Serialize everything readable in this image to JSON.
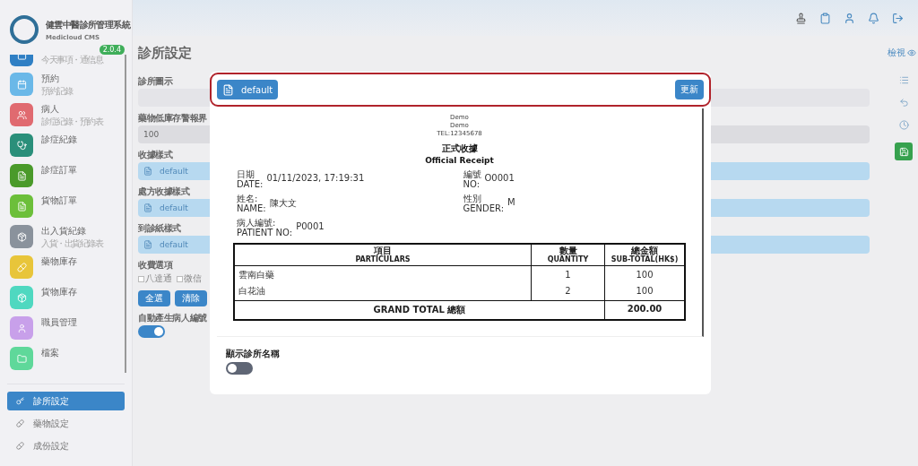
{
  "app": {
    "title": "健雲中醫診所管理系統",
    "subtitle": "Medicloud CMS",
    "version": "2.0.4"
  },
  "nav": [
    {
      "sub": "今天事項・通信息",
      "color": "#2f7fc4"
    },
    {
      "label": "預約",
      "sub": "預約記錄",
      "color": "#6ab8e8"
    },
    {
      "label": "病人",
      "sub": "診症紀錄・預約表",
      "color": "#e06a70"
    },
    {
      "label": "診症紀錄",
      "color": "#2a8f7a"
    },
    {
      "label": "診症訂單",
      "color": "#4a9a2a"
    },
    {
      "label": "貨物訂單",
      "color": "#6cbf3a"
    },
    {
      "label": "出入貨紀錄",
      "sub": "入貨・出貨紀錄表",
      "color": "#8a929c"
    },
    {
      "label": "藥物庫存",
      "color": "#e8c53a"
    },
    {
      "label": "貨物庫存",
      "color": "#4fd8c0"
    },
    {
      "label": "職員管理",
      "color": "#c8a0ea"
    },
    {
      "label": "檔案",
      "color": "#5fd89a"
    }
  ],
  "settings_nav": [
    {
      "label": "診所設定",
      "selected": true
    },
    {
      "label": "藥物設定",
      "selected": false
    },
    {
      "label": "成份設定",
      "selected": false
    }
  ],
  "page": {
    "title": "診所設定",
    "view_link": "檢視"
  },
  "fields": [
    {
      "kind": "empty",
      "label": "診所圖示"
    },
    {
      "kind": "number",
      "label": "藥物低庫存警報界",
      "value": "100"
    },
    {
      "kind": "template",
      "label": "收據樣式",
      "value": "default"
    },
    {
      "kind": "template",
      "label": "處方收據樣式",
      "value": "default"
    },
    {
      "kind": "template",
      "label": "到診紙樣式",
      "value": "default"
    },
    {
      "kind": "checks",
      "label": "收費選項",
      "options": [
        {
          "label": "八達通",
          "checked": false
        },
        {
          "label": "微信",
          "checked": false
        }
      ]
    },
    {
      "kind": "buttons",
      "buttons": [
        "全選",
        "清除"
      ]
    },
    {
      "kind": "toggle",
      "label": "自動產生病人編號",
      "on": true
    }
  ],
  "modal": {
    "template_button": "default",
    "update_button": "更新",
    "receipt": {
      "header": [
        "Demo",
        "Demo",
        "TEL:12345678"
      ],
      "title_zh": "正式收據",
      "title_en": "Official Receipt",
      "info": [
        [
          {
            "zh": "日期",
            "en": "DATE:",
            "value": "01/11/2023, 17:19:31"
          },
          {
            "zh": "編號",
            "en": "NO:",
            "value": "O0001"
          }
        ],
        [
          {
            "zh": "姓名:",
            "en": "NAME:",
            "value": "陳大文"
          },
          {
            "zh": "性別",
            "en": "GENDER:",
            "value": "M"
          }
        ],
        [
          {
            "zh": "病人編號:",
            "en": "PATIENT NO:",
            "value": "P0001"
          }
        ]
      ],
      "columns": [
        {
          "zh": "項目",
          "en": "PARTICULARS"
        },
        {
          "zh": "數量",
          "en": "QUANTITY"
        },
        {
          "zh": "總金額",
          "en": "SUB-TOTAL(HK$)"
        }
      ],
      "rows": [
        [
          "雲南白藥",
          "1",
          "100"
        ],
        [
          "白花油",
          "2",
          "100"
        ]
      ],
      "total_label": "GRAND TOTAL 總額",
      "total": "200.00"
    },
    "show_name": {
      "label": "顯示診所名稱",
      "on": false
    }
  }
}
